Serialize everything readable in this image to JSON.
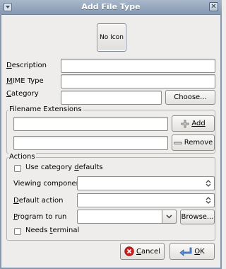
{
  "window": {
    "title": "Add File Type"
  },
  "icon_button": {
    "label": "No Icon"
  },
  "fields": {
    "description": {
      "label_mnemonic": "D",
      "label_rest": "escription",
      "value": ""
    },
    "mime_type": {
      "label_mnemonic": "M",
      "label_rest": "IME Type",
      "value": ""
    },
    "category": {
      "label_mnemonic": "C",
      "label_rest": "ategory",
      "value": ""
    },
    "choose_button": "Choose..."
  },
  "filename_extensions": {
    "title": "Filename Extensions",
    "extension_value": "",
    "add_label": "Add",
    "remove_label": "Remove"
  },
  "actions": {
    "title": "Actions",
    "use_category_defaults": {
      "label_pre": "Use category ",
      "label_mnemonic": "d",
      "label_post": "efaults",
      "checked": false
    },
    "viewing_component": {
      "label": "Viewing component",
      "value": ""
    },
    "default_action": {
      "label_mnemonic": "D",
      "label_rest": "efault action",
      "value": ""
    },
    "program_to_run": {
      "label_mnemonic": "P",
      "label_rest": "rogram to run",
      "value": ""
    },
    "browse_button": "Browse...",
    "needs_terminal": {
      "label_pre": "Needs ",
      "label_mnemonic": "t",
      "label_post": "erminal",
      "checked": false
    }
  },
  "buttons": {
    "cancel": {
      "mnemonic": "C",
      "rest": "ancel"
    },
    "ok": {
      "mnemonic": "O",
      "rest": "K"
    }
  },
  "colors": {
    "titlebar": "#8699b2",
    "background": "#eeedeb",
    "cancel_icon": "#cc2020",
    "ok_icon": "#3a6fbf"
  }
}
